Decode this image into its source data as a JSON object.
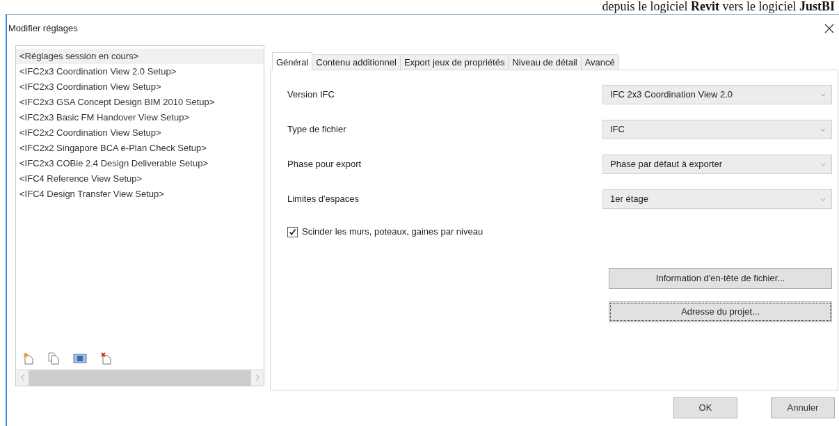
{
  "background_text": "depuis le logiciel **Revit** vers le logiciel **JustBI**",
  "window": {
    "title": "Modifier réglages"
  },
  "setups": [
    {
      "label": "<Réglages session en cours>",
      "selected": true
    },
    {
      "label": "<IFC2x3 Coordination View 2.0 Setup>",
      "selected": false
    },
    {
      "label": "<IFC2x3 Coordination View Setup>",
      "selected": false
    },
    {
      "label": "<IFC2x3 GSA Concept Design BIM 2010 Setup>",
      "selected": false
    },
    {
      "label": "<IFC2x3 Basic FM Handover View Setup>",
      "selected": false
    },
    {
      "label": "<IFC2x2 Coordination View Setup>",
      "selected": false
    },
    {
      "label": "<IFC2x2 Singapore BCA e-Plan Check Setup>",
      "selected": false
    },
    {
      "label": "<IFC2x3 COBie 2.4 Design Deliverable Setup>",
      "selected": false
    },
    {
      "label": "<IFC4 Reference View Setup>",
      "selected": false
    },
    {
      "label": "<IFC4 Design Transfer View Setup>",
      "selected": false
    }
  ],
  "tabs": [
    {
      "label": "Général",
      "selected": true
    },
    {
      "label": "Contenu additionnel",
      "selected": false
    },
    {
      "label": "Export jeux de propriétés",
      "selected": false
    },
    {
      "label": "Niveau de détail",
      "selected": false
    },
    {
      "label": "Avancé",
      "selected": false
    }
  ],
  "fields": [
    {
      "label": "Version IFC",
      "value": "IFC 2x3 Coordination View 2.0"
    },
    {
      "label": "Type de fichier",
      "value": "IFC"
    },
    {
      "label": "Phase pour export",
      "value": "Phase par défaut à exporter"
    },
    {
      "label": "Limites d'espaces",
      "value": "1er étage"
    }
  ],
  "split_option": {
    "label": "Scinder les murs, poteaux, gaines par niveau",
    "checked": true
  },
  "panel_buttons": [
    {
      "label": "Information d'en-tête de fichier...",
      "focused": false
    },
    {
      "label": "Adresse du projet...",
      "focused": true
    }
  ],
  "buttons": [
    "OK",
    "Annuler"
  ]
}
